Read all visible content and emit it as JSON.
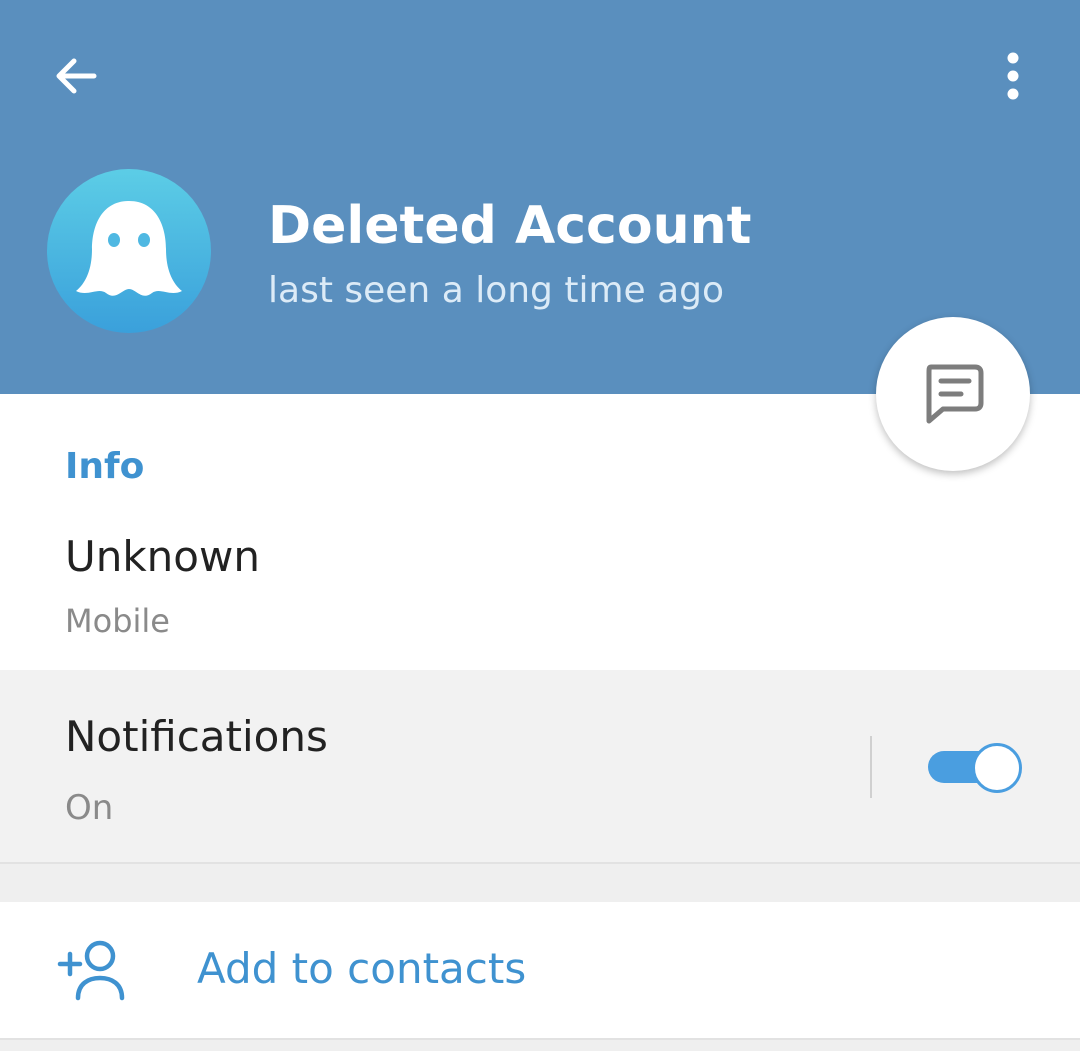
{
  "colors": {
    "header_bg": "#5a8fbe",
    "accent": "#3f92d0",
    "toggle_on": "#4a9ee0",
    "avatar_gradient_top": "#5ccde6",
    "avatar_gradient_bottom": "#3aa0db"
  },
  "header": {
    "back_icon": "arrow-left-icon",
    "menu_icon": "more-vertical-icon"
  },
  "profile": {
    "name": "Deleted Account",
    "status": "last seen a long time ago",
    "avatar_icon": "ghost-icon"
  },
  "fab": {
    "icon": "message-icon"
  },
  "info": {
    "heading": "Info",
    "phone_value": "Unknown",
    "phone_label": "Mobile"
  },
  "notifications": {
    "title": "Notifications",
    "status": "On",
    "enabled": true
  },
  "actions": {
    "add_contact_label": "Add to contacts",
    "add_contact_icon": "add-user-icon"
  }
}
